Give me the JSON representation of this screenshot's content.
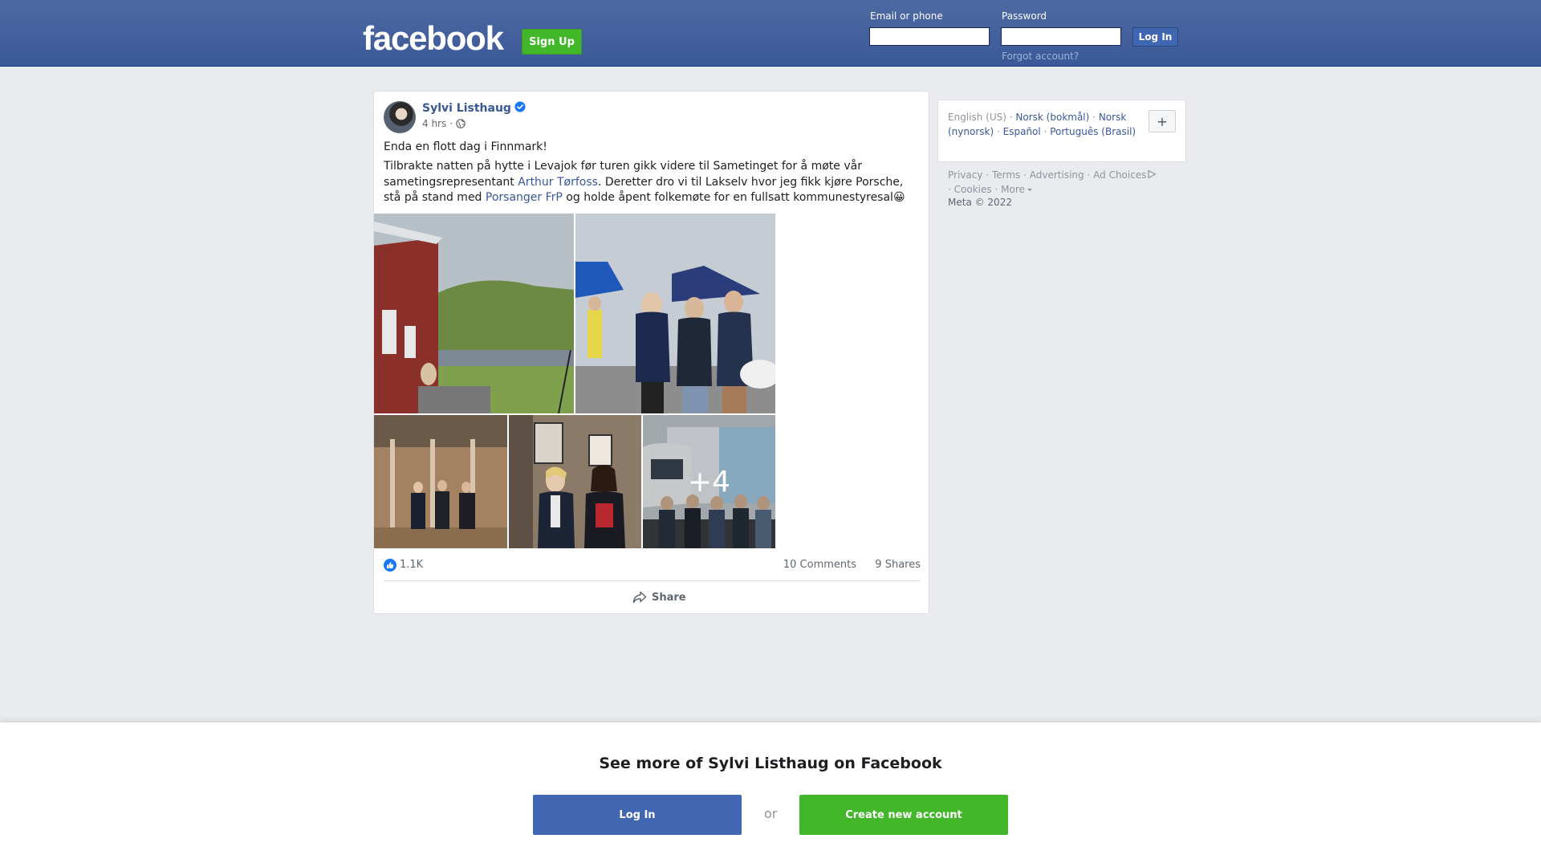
{
  "header": {
    "logo": "facebook",
    "signup_label": "Sign Up",
    "email_label": "Email or phone",
    "password_label": "Password",
    "login_label": "Log In",
    "forgot_label": "Forgot account?"
  },
  "post": {
    "author": "Sylvi Listhaug",
    "time": "4 hrs",
    "time_separator": "·",
    "text_line1": "Enda en flott dag i Finnmark!",
    "text_part1": "Tilbrakte natten på hytte i Levajok før turen gikk videre til Sametinget for å møte vår sametingsrepresentant ",
    "link1": "Arthur Tørfoss",
    "text_part2": ". Deretter dro vi til Lakselv hvor jeg fikk kjøre Porsche, stå på stand med ",
    "link2": "Porsanger FrP",
    "text_part3": " og holde åpent folkemøte for en fullsatt kommunestyresal😀",
    "more_photos": "+4",
    "likes": "1.1K",
    "comments": "10 Comments",
    "shares": "9 Shares",
    "share_label": "Share"
  },
  "sidebar": {
    "lang_current": "English (US)",
    "lang_links": [
      "Norsk (bokmål)",
      "Norsk (nynorsk)",
      "Español",
      "Português (Brasil)"
    ],
    "sep": "·",
    "add_lang": "+",
    "footer_links": [
      "Privacy",
      "Terms",
      "Advertising",
      "Ad Choices",
      "Cookies",
      "More"
    ],
    "copyright": "Meta © 2022"
  },
  "banner": {
    "title": "See more of Sylvi Listhaug on Facebook",
    "login_label": "Log In",
    "or_label": "or",
    "create_label": "Create new account"
  },
  "colors": {
    "brand_blue": "#3b5998",
    "green": "#42b72a",
    "link": "#385898"
  }
}
